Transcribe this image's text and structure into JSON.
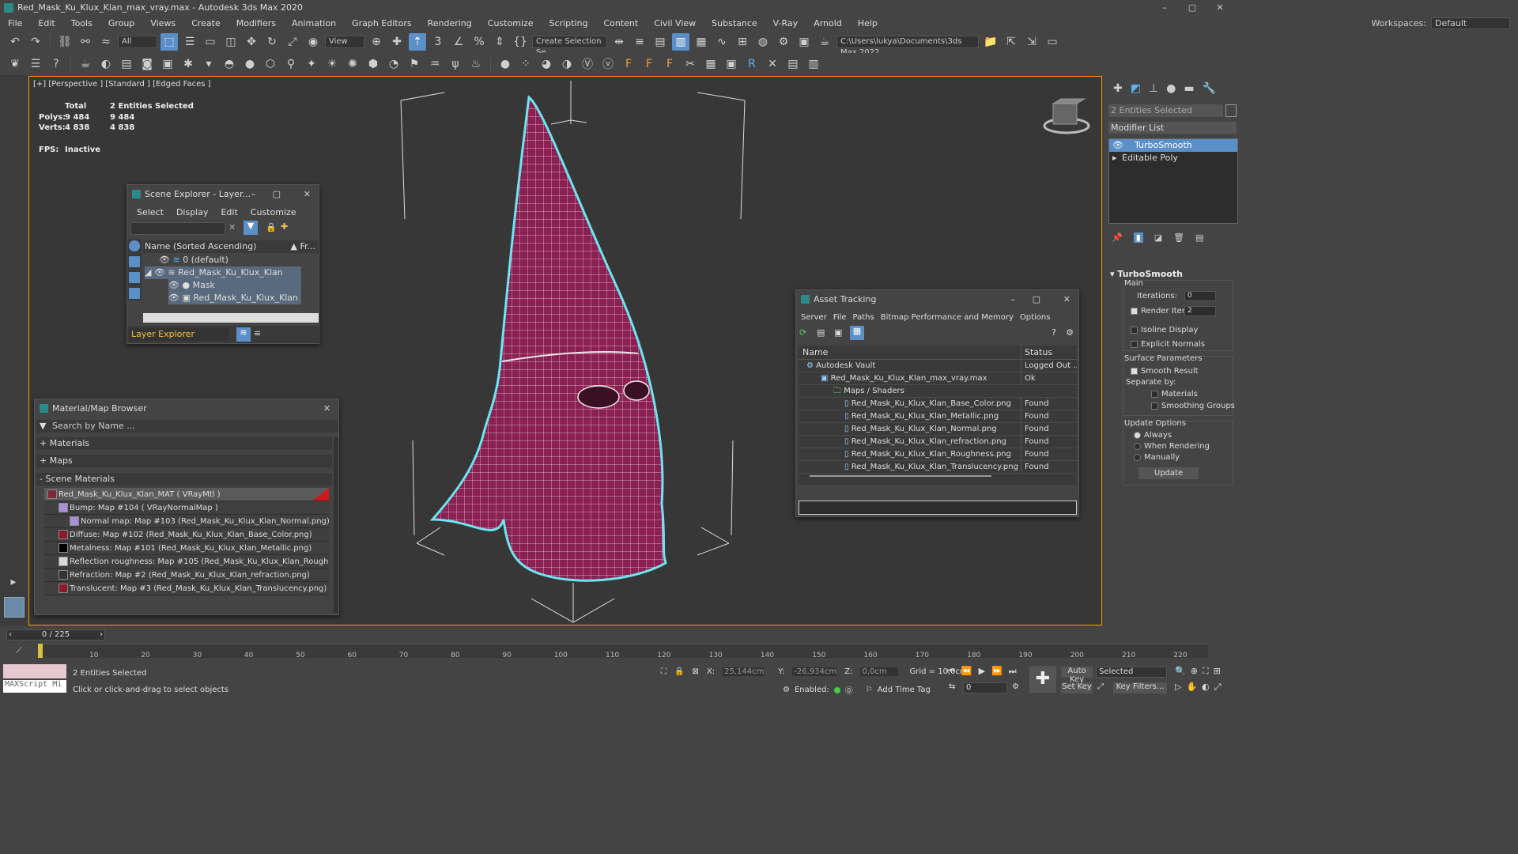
{
  "title": "Red_Mask_Ku_Klux_Klan_max_vray.max - Autodesk 3ds Max 2020",
  "menus": [
    "File",
    "Edit",
    "Tools",
    "Group",
    "Views",
    "Create",
    "Modifiers",
    "Animation",
    "Graph Editors",
    "Rendering",
    "Customize",
    "Scripting",
    "Content",
    "Civil View",
    "Substance",
    "V-Ray",
    "Arnold",
    "Help"
  ],
  "workspaces_label": "Workspaces:",
  "workspace_value": "Default",
  "toolbar": {
    "filter_value": "All",
    "view_value": "View",
    "selection_set": "Create Selection Se",
    "path_value": "C:\\Users\\lukya\\Documents\\3ds Max 2022"
  },
  "viewport": {
    "label": "[+] [Perspective ] [Standard ] [Edged Faces ]",
    "total_label": "Total",
    "selected_label": "2 Entities Selected",
    "polys_label": "Polys:",
    "polys_total": "9 484",
    "polys_sel": "9 484",
    "verts_label": "Verts:",
    "verts_total": "4 838",
    "verts_sel": "4 838",
    "fps_label": "FPS:",
    "fps_value": "Inactive"
  },
  "scene_explorer": {
    "title": "Scene Explorer - Layer...",
    "menus": [
      "Select",
      "Display",
      "Edit",
      "Customize"
    ],
    "col_name": "Name (Sorted Ascending)",
    "col_fr": "▲ Fr...",
    "rows": [
      "0 (default)",
      "Red_Mask_Ku_Klux_Klan",
      "Mask",
      "Red_Mask_Ku_Klux_Klan"
    ],
    "footer": "Layer Explorer"
  },
  "material_browser": {
    "title": "Material/Map Browser",
    "search": "Search by Name ...",
    "sections": [
      "+ Materials",
      "+ Maps",
      "- Scene Materials"
    ],
    "items": [
      "Red_Mask_Ku_Klux_Klan_MAT ( VRayMtl )",
      "Bump: Map #104 ( VRayNormalMap )",
      "Normal map: Map #103 (Red_Mask_Ku_Klux_Klan_Normal.png)",
      "Diffuse: Map #102 (Red_Mask_Ku_Klux_Klan_Base_Color.png)",
      "Metalness: Map #101 (Red_Mask_Ku_Klux_Klan_Metallic.png)",
      "Reflection roughness: Map #105 (Red_Mask_Ku_Klux_Klan_Roughness.png)",
      "Refraction: Map #2 (Red_Mask_Ku_Klux_Klan_refraction.png)",
      "Translucent: Map #3 (Red_Mask_Ku_Klux_Klan_Translucency.png)"
    ],
    "swatch_colors": [
      "#7a2a38",
      "#a890d8",
      "#a890d8",
      "#8b1a2a",
      "#000000",
      "#d8d8d8",
      "#333333",
      "#8b1a2a"
    ]
  },
  "asset_tracking": {
    "title": "Asset Tracking",
    "menus": [
      "Server",
      "File",
      "Paths",
      "Bitmap Performance and Memory",
      "Options"
    ],
    "col_name": "Name",
    "col_status": "Status",
    "rows": [
      {
        "name": "Autodesk Vault",
        "status": "Logged Out ..."
      },
      {
        "name": "Red_Mask_Ku_Klux_Klan_max_vray.max",
        "status": "Ok"
      },
      {
        "name": "Maps / Shaders",
        "status": ""
      },
      {
        "name": "Red_Mask_Ku_Klux_Klan_Base_Color.png",
        "status": "Found"
      },
      {
        "name": "Red_Mask_Ku_Klux_Klan_Metallic.png",
        "status": "Found"
      },
      {
        "name": "Red_Mask_Ku_Klux_Klan_Normal.png",
        "status": "Found"
      },
      {
        "name": "Red_Mask_Ku_Klux_Klan_refraction.png",
        "status": "Found"
      },
      {
        "name": "Red_Mask_Ku_Klux_Klan_Roughness.png",
        "status": "Found"
      },
      {
        "name": "Red_Mask_Ku_Klux_Klan_Translucency.png",
        "status": "Found"
      }
    ]
  },
  "command_panel": {
    "selection": "2 Entities Selected",
    "modifier_list": "Modifier List",
    "stack": [
      "TurboSmooth",
      "Editable Poly"
    ],
    "rollout_title": "TurboSmooth",
    "main_label": "Main",
    "iterations_label": "Iterations:",
    "iterations_value": "0",
    "render_iters_label": "Render Iters:",
    "render_iters_value": "2",
    "isoline_label": "Isoline Display",
    "explicit_label": "Explicit Normals",
    "surface_label": "Surface Parameters",
    "smooth_label": "Smooth Result",
    "separate_label": "Separate by:",
    "materials_label": "Materials",
    "smoothing_label": "Smoothing Groups",
    "update_label": "Update Options",
    "always_label": "Always",
    "when_rendering_label": "When Rendering",
    "manually_label": "Manually",
    "update_button": "Update"
  },
  "timeline": {
    "frame": "0 / 225",
    "ticks": [
      "10",
      "20",
      "30",
      "40",
      "50",
      "60",
      "70",
      "80",
      "90",
      "100",
      "110",
      "120",
      "130",
      "140",
      "150",
      "160",
      "170",
      "180",
      "190",
      "200",
      "210",
      "220"
    ]
  },
  "status": {
    "maxscript": "MAXScript Mi",
    "selected": "2 Entities Selected",
    "hint": "Click or click-and-drag to select objects",
    "x_label": "X:",
    "x_value": "25,144cm",
    "y_label": "Y:",
    "y_value": "-26,934cm",
    "z_label": "Z:",
    "z_value": "0,0cm",
    "grid": "Grid = 10,0cm",
    "enabled": "Enabled:",
    "add_time_tag": "Add Time Tag",
    "autokey": "Auto Key",
    "selected_dd": "Selected",
    "setkey": "Set Key",
    "key_filters": "Key Filters...",
    "frame_value": "0"
  }
}
